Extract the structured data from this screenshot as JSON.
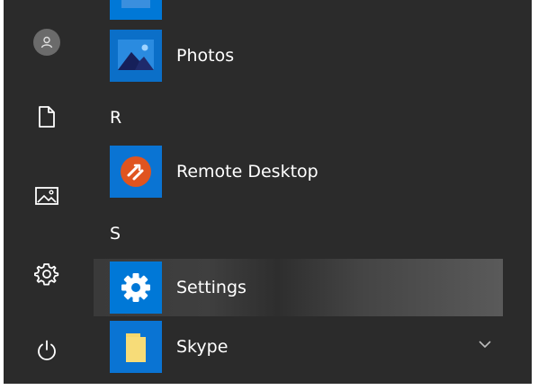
{
  "start_menu": {
    "groups": [
      {
        "letter": "R"
      },
      {
        "letter": "S"
      }
    ],
    "apps": {
      "photos": {
        "label": "Photos"
      },
      "remote_desktop": {
        "label": "Remote Desktop"
      },
      "settings": {
        "label": "Settings"
      },
      "skype": {
        "label": "Skype"
      }
    }
  },
  "rail": {
    "items": [
      {
        "icon": "user-avatar-icon"
      },
      {
        "icon": "document-icon"
      },
      {
        "icon": "pictures-icon"
      },
      {
        "icon": "gear-icon"
      },
      {
        "icon": "power-icon"
      }
    ]
  },
  "colors": {
    "background": "#2b2b2b",
    "tile_accent": "#0078d7",
    "text": "#ffffff",
    "remote_desktop_orange": "#e0541f",
    "skype_folder": "#f5d76e"
  }
}
